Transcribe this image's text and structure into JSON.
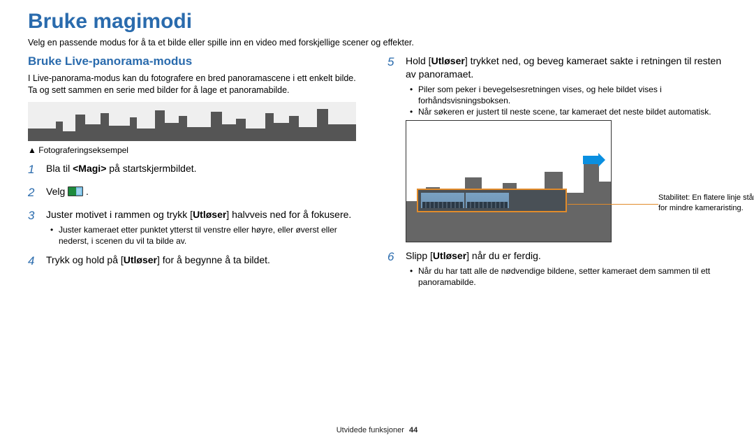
{
  "title": "Bruke magimodi",
  "intro": "Velg en passende modus for å ta et bilde eller spille inn en video med forskjellige scener og effekter.",
  "left": {
    "subhead": "Bruke Live-panorama-modus",
    "desc": "I Live-panorama-modus kan du fotografere en bred panoramascene i ett enkelt bilde. Ta og sett sammen en serie med bilder for å lage et panoramabilde.",
    "caption_tri": "▲",
    "caption": "Fotograferingseksempel",
    "steps": {
      "s1": {
        "num": "1",
        "pre": "Bla til ",
        "bold": "<Magi>",
        "post": " på startskjermbildet."
      },
      "s2": {
        "num": "2",
        "text": "Velg "
      },
      "s3": {
        "num": "3",
        "pre": "Juster motivet i rammen og trykk [",
        "bold": "Utløser",
        "post": "] halvveis ned for å fokusere.",
        "sub1": "Juster kameraet etter punktet ytterst til venstre eller høyre, eller øverst eller nederst, i scenen du vil ta bilde av."
      },
      "s4": {
        "num": "4",
        "pre": "Trykk og hold på [",
        "bold": "Utløser",
        "post": "] for å begynne å ta bildet."
      }
    }
  },
  "right": {
    "steps": {
      "s5": {
        "num": "5",
        "pre": "Hold [",
        "bold": "Utløser",
        "post": "] trykket ned, og beveg kameraet sakte i retningen til resten av panoramaet.",
        "sub1": "Piler som peker i bevegelsesretningen vises, og hele bildet vises i forhåndsvisningsboksen.",
        "sub2": "Når søkeren er justert til neste scene, tar kameraet det neste bildet automatisk."
      },
      "s6": {
        "num": "6",
        "pre": "Slipp [",
        "bold": "Utløser",
        "post": "] når du er ferdig.",
        "sub1": "Når du har tatt alle de nødvendige bildene, setter kameraet dem sammen til ett panoramabilde."
      }
    },
    "callout": "Stabilitet: En flatere linje står for mindre kameraristing."
  },
  "footer": {
    "section": "Utvidede funksjoner",
    "page": "44"
  }
}
